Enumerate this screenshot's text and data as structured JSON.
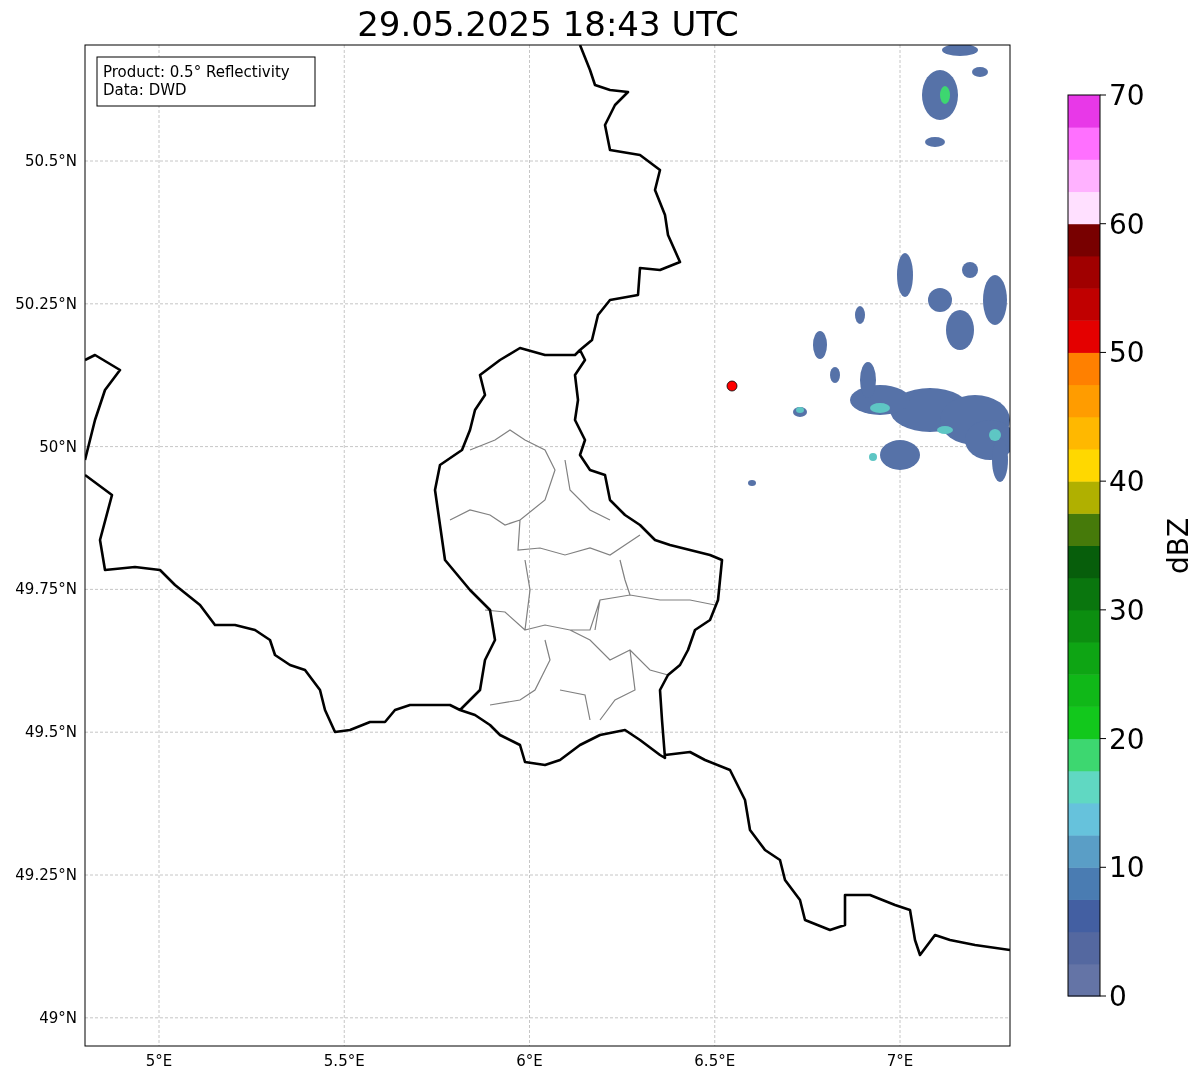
{
  "title": "29.05.2025 18:43 UTC",
  "info_box": {
    "lines": [
      "Product: 0.5° Reflectivity",
      "Data: DWD"
    ]
  },
  "x_ticks": [
    "5°E",
    "5.5°E",
    "6°E",
    "6.5°E",
    "7°E"
  ],
  "y_ticks": [
    "50.5°N",
    "50.25°N",
    "50°N",
    "49.75°N",
    "49.5°N",
    "49.25°N",
    "49°N"
  ],
  "colorbar": {
    "label": "dBZ",
    "ticks": [
      "70",
      "60",
      "50",
      "40",
      "30",
      "20",
      "10",
      "0"
    ],
    "bands": [
      {
        "color": "#6474a6"
      },
      {
        "color": "#5468a0"
      },
      {
        "color": "#435fa2"
      },
      {
        "color": "#4a7cb2"
      },
      {
        "color": "#5a9ec6"
      },
      {
        "color": "#66c2dc"
      },
      {
        "color": "#60d8c2"
      },
      {
        "color": "#3dd770"
      },
      {
        "color": "#12c81c"
      },
      {
        "color": "#10b818"
      },
      {
        "color": "#0ea514"
      },
      {
        "color": "#0c8e10"
      },
      {
        "color": "#0a760e"
      },
      {
        "color": "#075e0b"
      },
      {
        "color": "#467a0a"
      },
      {
        "color": "#b0b000"
      },
      {
        "color": "#ffd800"
      },
      {
        "color": "#ffb800"
      },
      {
        "color": "#ff9c00"
      },
      {
        "color": "#ff8000"
      },
      {
        "color": "#e40000"
      },
      {
        "color": "#c00000"
      },
      {
        "color": "#a00000"
      },
      {
        "color": "#780000"
      },
      {
        "color": "#ffe0ff"
      },
      {
        "color": "#ffb2ff"
      },
      {
        "color": "#ff70ff"
      },
      {
        "color": "#e838e8"
      }
    ]
  }
}
